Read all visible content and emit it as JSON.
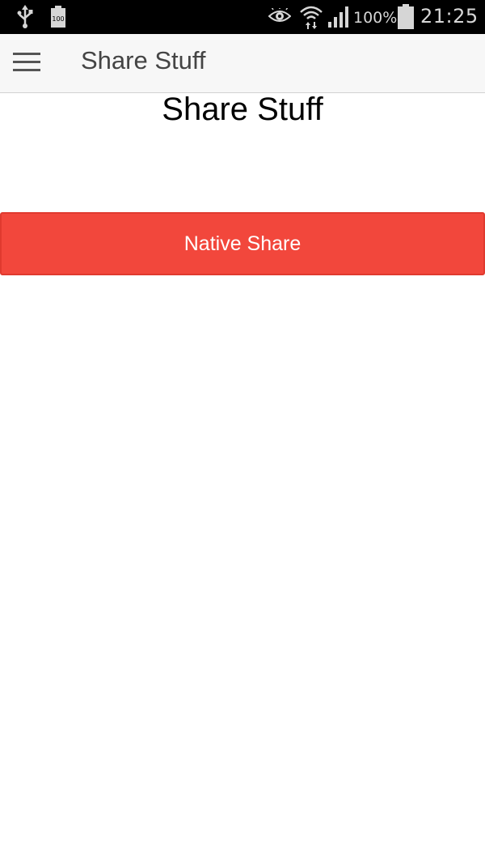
{
  "status_bar": {
    "battery_small_label": "100",
    "battery_percent": "100%",
    "time": "21:25",
    "icons": [
      "usb-icon",
      "battery-small-icon",
      "eye-icon",
      "wifi-icon",
      "signal-icon",
      "battery-icon"
    ]
  },
  "app_bar": {
    "menu_icon": "hamburger-menu-icon",
    "title": "Share Stuff"
  },
  "main": {
    "heading": "Share Stuff",
    "native_share_label": "Native Share"
  },
  "colors": {
    "status_bar_bg": "#000000",
    "app_bar_bg": "#f7f7f7",
    "button_bg": "#f2473c",
    "button_text": "#ffffff"
  }
}
